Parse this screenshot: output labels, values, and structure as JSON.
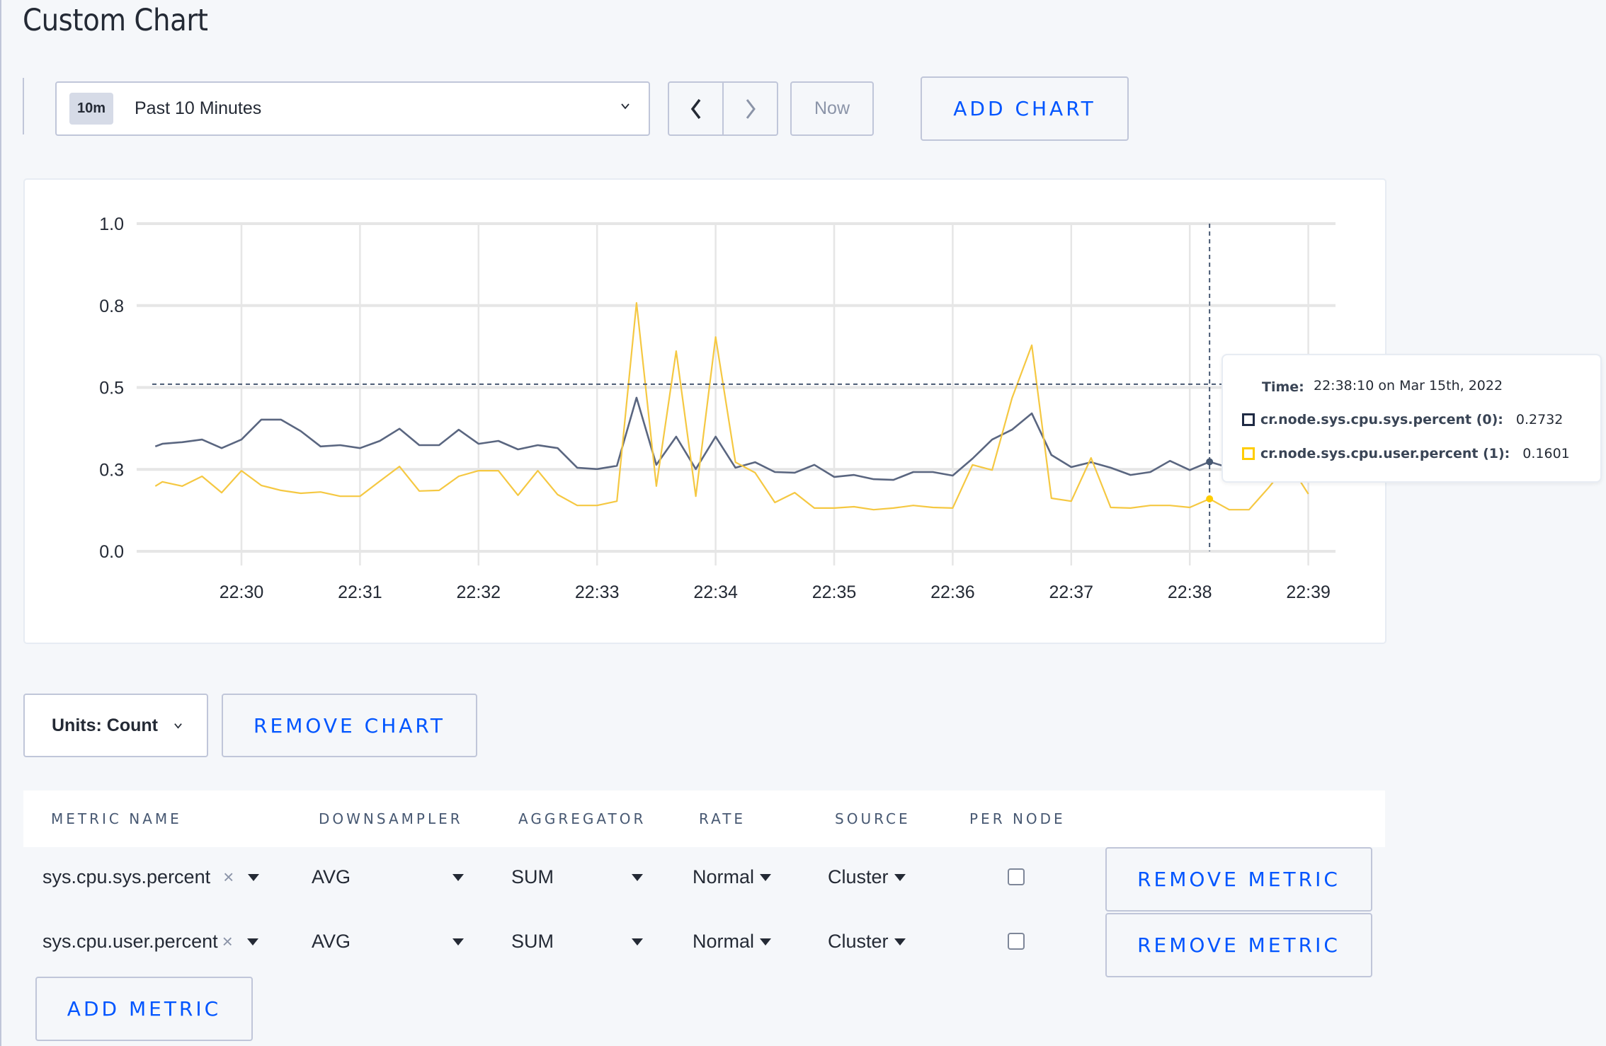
{
  "page": {
    "title": "Custom Chart"
  },
  "toolbar": {
    "time_badge": "10m",
    "time_label": "Past 10 Minutes",
    "prev_icon": "chevron-left-icon",
    "next_icon": "chevron-right-icon",
    "now_label": "Now",
    "add_chart_label": "ADD CHART"
  },
  "tooltip": {
    "time_label": "Time:",
    "time_value": "22:38:10 on Mar 15th, 2022",
    "rows": [
      {
        "name": "cr.node.sys.cpu.sys.percent (0):",
        "value": "0.2732",
        "color": "#1f2a44"
      },
      {
        "name": "cr.node.sys.cpu.user.percent (1):",
        "value": "0.1601",
        "color": "#ffcd02"
      }
    ]
  },
  "chart_controls": {
    "units_label": "Units: Count",
    "remove_chart_label": "REMOVE CHART"
  },
  "metrics_table": {
    "headers": [
      "METRIC NAME",
      "DOWNSAMPLER",
      "AGGREGATOR",
      "RATE",
      "SOURCE",
      "PER NODE"
    ],
    "rows": [
      {
        "metric": "sys.cpu.sys.percent",
        "downsampler": "AVG",
        "aggregator": "SUM",
        "rate": "Normal",
        "source": "Cluster",
        "per_node": false,
        "remove_label": "REMOVE METRIC"
      },
      {
        "metric": "sys.cpu.user.percent",
        "downsampler": "AVG",
        "aggregator": "SUM",
        "rate": "Normal",
        "source": "Cluster",
        "per_node": false,
        "remove_label": "REMOVE METRIC"
      }
    ],
    "clear_icon": "×",
    "add_metric_label": "ADD METRIC"
  },
  "chart_data": {
    "type": "line",
    "title": "",
    "xlabel": "",
    "ylabel": "",
    "ylim": [
      0,
      1
    ],
    "yticks": [
      0,
      0.25,
      0.5,
      0.75,
      1.0
    ],
    "ytick_labels": [
      "0.0",
      "0.3",
      "0.5",
      "0.8",
      "1.0"
    ],
    "x_unit": "minutes since 22:29",
    "xlim": [
      0.273,
      10.0
    ],
    "xticks": [
      1,
      2,
      3,
      4,
      5,
      6,
      7,
      8,
      9,
      10
    ],
    "xtick_labels": [
      "22:30",
      "22:31",
      "22:32",
      "22:33",
      "22:34",
      "22:35",
      "22:36",
      "22:37",
      "22:38",
      "22:39"
    ],
    "grid": true,
    "legend": "tooltip",
    "hover": {
      "x": 9.167,
      "y_crosshair": 0.51
    },
    "x": [
      0.273,
      0.333,
      0.5,
      0.667,
      0.833,
      1.0,
      1.167,
      1.333,
      1.5,
      1.667,
      1.833,
      2.0,
      2.167,
      2.333,
      2.5,
      2.667,
      2.833,
      3.0,
      3.167,
      3.333,
      3.5,
      3.667,
      3.833,
      4.0,
      4.167,
      4.333,
      4.5,
      4.667,
      4.833,
      5.0,
      5.167,
      5.333,
      5.5,
      5.667,
      5.833,
      6.0,
      6.167,
      6.333,
      6.5,
      6.667,
      6.833,
      7.0,
      7.167,
      7.333,
      7.5,
      7.667,
      7.833,
      8.0,
      8.167,
      8.333,
      8.5,
      8.667,
      8.833,
      9.0,
      9.167,
      9.333,
      9.5,
      9.667,
      9.833,
      10.0
    ],
    "series": [
      {
        "name": "cr.node.sys.cpu.sys.percent",
        "color": "#5a6680",
        "values": [
          0.32,
          0.328,
          0.333,
          0.341,
          0.315,
          0.341,
          0.402,
          0.402,
          0.367,
          0.32,
          0.324,
          0.315,
          0.337,
          0.374,
          0.324,
          0.324,
          0.371,
          0.328,
          0.337,
          0.311,
          0.324,
          0.315,
          0.255,
          0.251,
          0.261,
          0.469,
          0.264,
          0.35,
          0.251,
          0.35,
          0.255,
          0.272,
          0.242,
          0.24,
          0.264,
          0.227,
          0.233,
          0.22,
          0.218,
          0.242,
          0.242,
          0.231,
          0.283,
          0.341,
          0.371,
          0.421,
          0.294,
          0.257,
          0.272,
          0.255,
          0.233,
          0.242,
          0.276,
          0.248,
          0.2732,
          0.255,
          0.262,
          0.27,
          0.265,
          0.25
        ]
      },
      {
        "name": "cr.node.sys.cpu.user.percent",
        "color": "#f5c842",
        "values": [
          0.199,
          0.212,
          0.199,
          0.229,
          0.179,
          0.246,
          0.201,
          0.186,
          0.177,
          0.181,
          0.168,
          0.168,
          0.214,
          0.259,
          0.184,
          0.186,
          0.229,
          0.246,
          0.246,
          0.171,
          0.246,
          0.173,
          0.14,
          0.14,
          0.153,
          0.758,
          0.199,
          0.611,
          0.168,
          0.654,
          0.272,
          0.24,
          0.149,
          0.179,
          0.132,
          0.132,
          0.136,
          0.127,
          0.132,
          0.14,
          0.134,
          0.132,
          0.264,
          0.248,
          0.467,
          0.629,
          0.162,
          0.153,
          0.285,
          0.134,
          0.132,
          0.14,
          0.14,
          0.134,
          0.1601,
          0.127,
          0.127,
          0.195,
          0.27,
          0.175
        ]
      }
    ]
  }
}
